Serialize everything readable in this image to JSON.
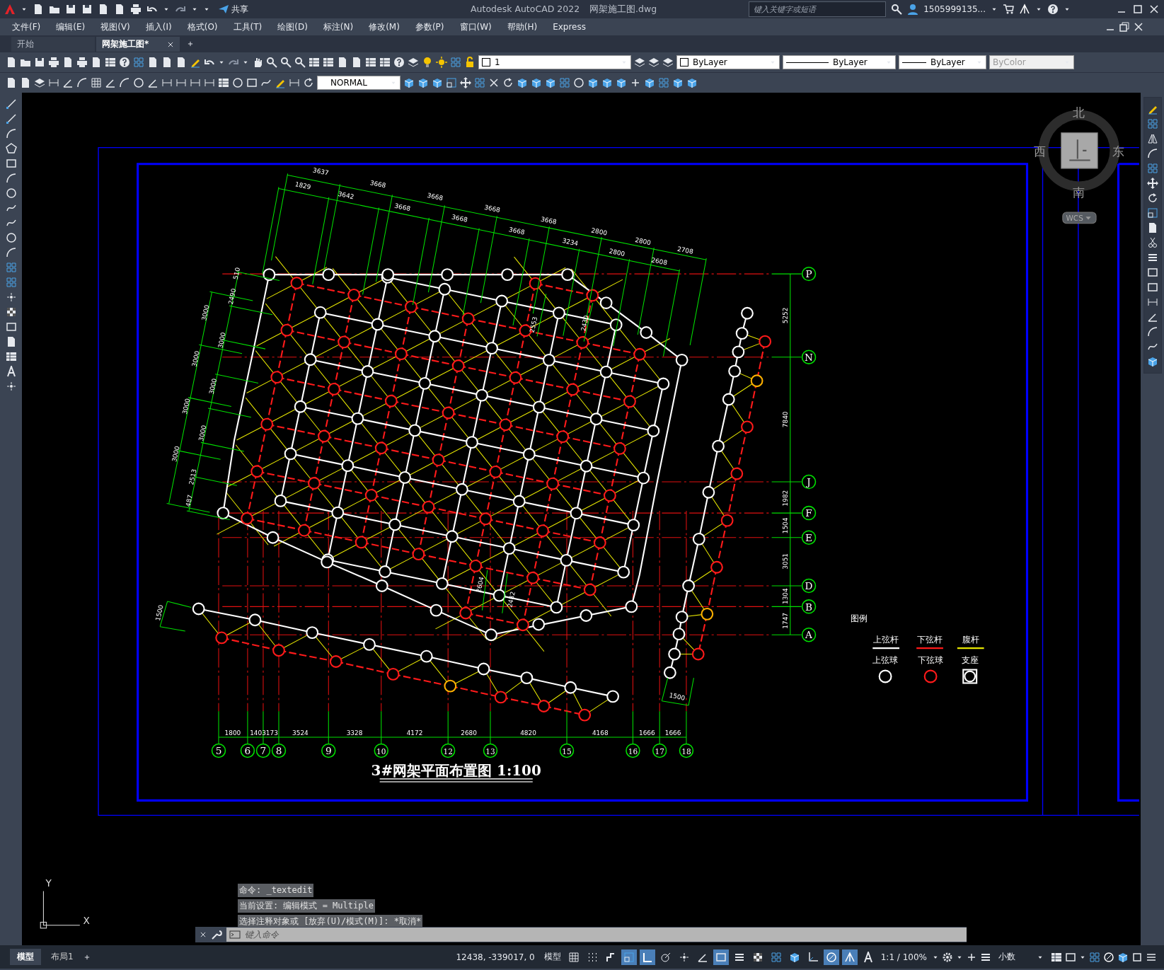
{
  "title_bar": {
    "share": "共享",
    "app_title": "Autodesk AutoCAD 2022",
    "file_name": "网架施工图.dwg",
    "search": {
      "placeholder": "键入关键字或短语"
    },
    "user": "1505999135..."
  },
  "menu": [
    "文件(F)",
    "编辑(E)",
    "视图(V)",
    "插入(I)",
    "格式(O)",
    "工具(T)",
    "绘图(D)",
    "标注(N)",
    "修改(M)",
    "参数(P)",
    "窗口(W)",
    "帮助(H)",
    "Express"
  ],
  "file_tabs": [
    {
      "label": "开始",
      "selected": false
    },
    {
      "label": "网架施工图*",
      "selected": true
    }
  ],
  "properties_toolbar": {
    "layer": "1",
    "color_setting": "ByLayer",
    "linetype": "ByLayer",
    "lineweight": "ByLayer",
    "plot_style": {
      "value": "ByColor",
      "disabled": true
    }
  },
  "text_style": "NORMAL",
  "drawing": {
    "top_dims_outer": [
      "3637",
      "3668",
      "3668",
      "3668",
      "3668",
      "2800",
      "2800",
      "2708"
    ],
    "top_dims_inner": [
      "1829",
      "3642",
      "3668",
      "3668",
      "3668",
      "3234",
      "2800",
      "2608"
    ],
    "left_dims_outer": [
      "3000",
      "3000",
      "3000",
      "3000"
    ],
    "left_dims_inner": [
      "510",
      "2490",
      "3000",
      "3000",
      "3000",
      "2513",
      "487"
    ],
    "inner_dims": [
      "2553",
      "2430",
      "2604",
      "2482",
      "1500",
      "1500"
    ],
    "row_axes": [
      "P",
      "N",
      "J",
      "F",
      "E",
      "D",
      "B",
      "A"
    ],
    "row_dims": [
      "5252",
      "7840",
      "1982",
      "1504",
      "3051",
      "1304",
      "1747"
    ],
    "column_axes": [
      "5",
      "6",
      "7",
      "8",
      "9",
      "10",
      "12",
      "13",
      "15",
      "16",
      "17",
      "18"
    ],
    "column_dims": [
      "1800",
      "1403173",
      "3524",
      "3328",
      "4172",
      "2680",
      "4820",
      "4168",
      "1666",
      "1666"
    ],
    "title": "3#网架平面布置图 1:100",
    "legend": {
      "title": "图例",
      "items": [
        {
          "label": "上弦杆",
          "kind": "upper-chord"
        },
        {
          "label": "下弦杆",
          "kind": "lower-chord"
        },
        {
          "label": "腹杆",
          "kind": "web"
        },
        {
          "label": "上弦球",
          "kind": "upper-node"
        },
        {
          "label": "下弦球",
          "kind": "lower-node"
        },
        {
          "label": "支座",
          "kind": "support"
        }
      ]
    }
  },
  "viewcube": {
    "north": "北",
    "west": "西",
    "east": "东",
    "south": "南",
    "wcs": "WCS"
  },
  "ucs": {
    "y": "Y",
    "x": "X"
  },
  "command_history": [
    "命令: _textedit",
    "当前设置: 编辑模式 = Multiple",
    "选择注释对象或 [放弃(U)/模式(M)]: *取消*"
  ],
  "command_line": {
    "placeholder": "键入命令"
  },
  "layout_tabs": [
    {
      "label": "模型",
      "selected": true
    },
    {
      "label": "布局1",
      "selected": false
    }
  ],
  "status_bar": {
    "coordinates": "12438, -339017, 0",
    "space": "模型",
    "scale": "1:1 / 100%",
    "units": "小数"
  },
  "status_toggles": [
    {
      "kind": "grid",
      "on": false
    },
    {
      "kind": "snap",
      "on": false
    },
    {
      "kind": "infer",
      "on": false
    },
    {
      "kind": "dynamic",
      "on": true
    },
    {
      "kind": "ortho",
      "on": true
    },
    {
      "kind": "polar",
      "on": false
    },
    {
      "kind": "track",
      "on": false
    },
    {
      "kind": "angle",
      "on": false
    },
    {
      "kind": "osnap",
      "on": true
    },
    {
      "kind": "lineweight",
      "on": false
    },
    {
      "kind": "transparency",
      "on": false
    },
    {
      "kind": "selection",
      "on": false
    },
    {
      "kind": "gizmo",
      "on": false
    },
    {
      "kind": "ucs",
      "on": false
    },
    {
      "kind": "isolate",
      "on": true
    },
    {
      "kind": "annotate",
      "on": true
    },
    {
      "kind": "autoscale",
      "on": false
    }
  ]
}
